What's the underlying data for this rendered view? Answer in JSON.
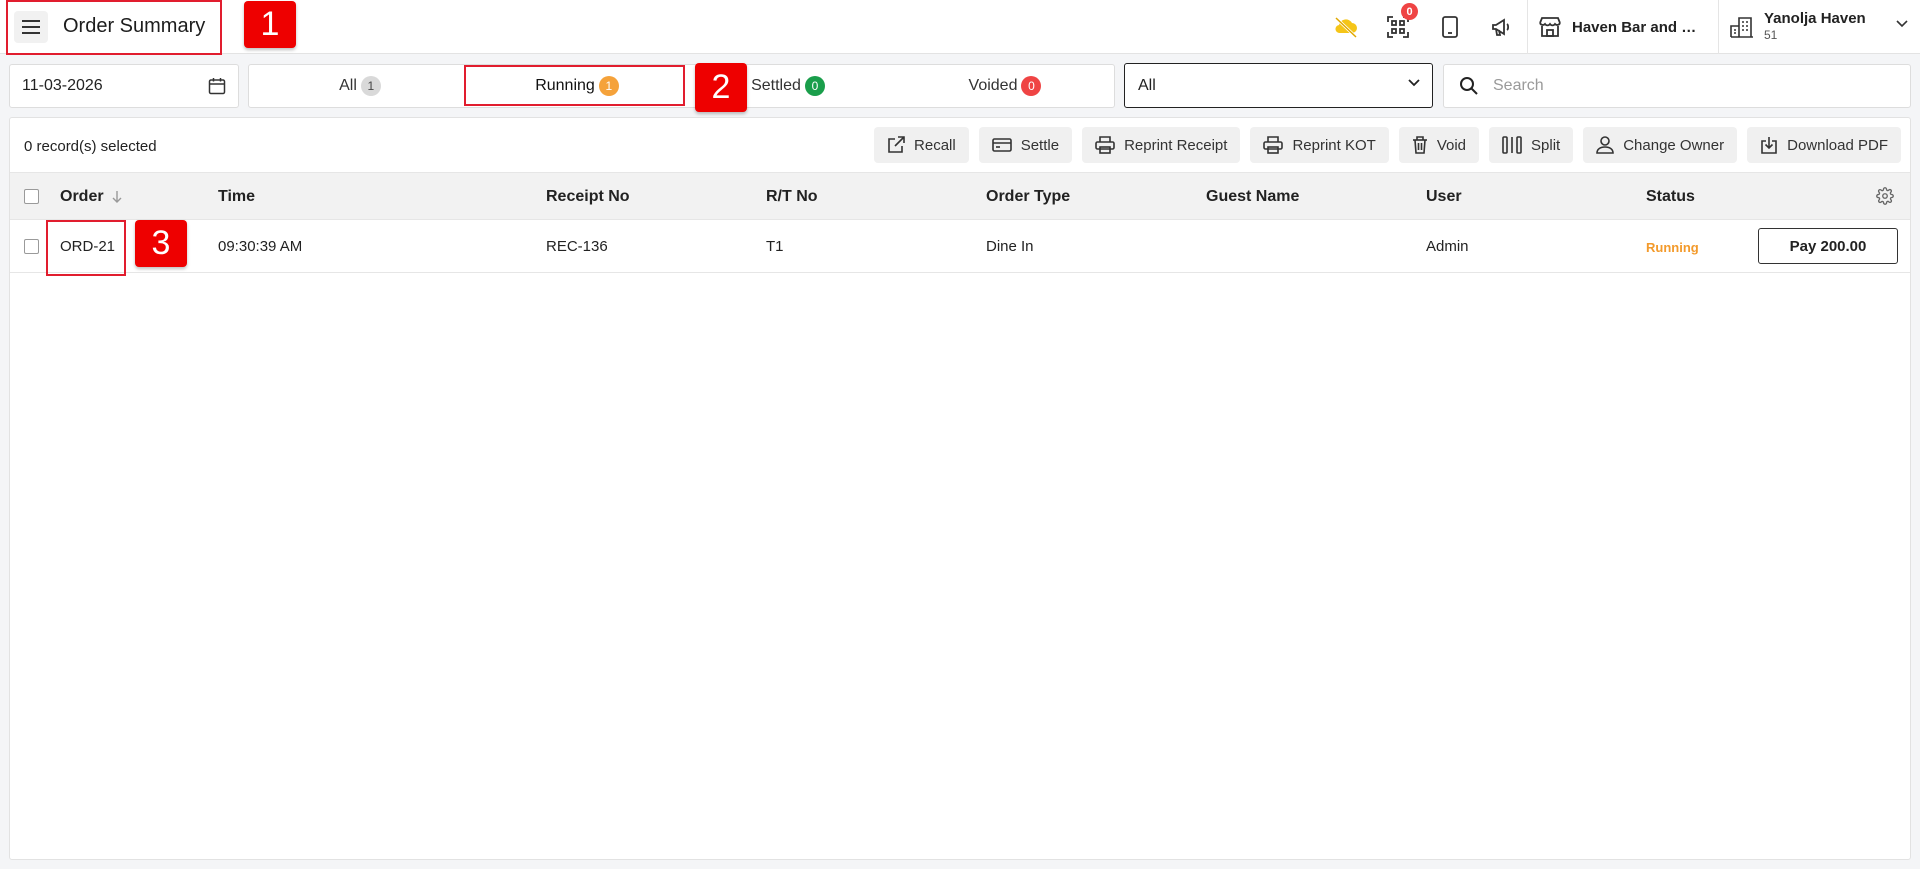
{
  "header": {
    "title": "Order Summary",
    "qr_badge_count": "0",
    "store_name": "Haven Bar and R...",
    "account_name": "Yanolja Haven",
    "account_id": "51"
  },
  "filters": {
    "date": "11-03-2026",
    "tabs": [
      {
        "label": "All",
        "count": "1",
        "color": "#d9d9d9",
        "text_color": "#444"
      },
      {
        "label": "Running",
        "count": "1",
        "color": "#f5a23a",
        "text_color": "#fff"
      },
      {
        "label": "Settled",
        "count": "0",
        "color": "#1a9e4b",
        "text_color": "#fff"
      },
      {
        "label": "Voided",
        "count": "0",
        "color": "#ef4444",
        "text_color": "#fff"
      }
    ],
    "active_tab": "Running",
    "order_type_selected": "All",
    "search_placeholder": "Search"
  },
  "toolbar": {
    "selected_text": "0 record(s) selected",
    "actions": [
      {
        "label": "Recall",
        "icon": "external-link-icon"
      },
      {
        "label": "Settle",
        "icon": "card-icon"
      },
      {
        "label": "Reprint Receipt",
        "icon": "printer-icon"
      },
      {
        "label": "Reprint KOT",
        "icon": "printer-icon"
      },
      {
        "label": "Void",
        "icon": "trash-icon"
      },
      {
        "label": "Split",
        "icon": "split-icon"
      },
      {
        "label": "Change Owner",
        "icon": "user-icon"
      },
      {
        "label": "Download PDF",
        "icon": "download-icon"
      }
    ]
  },
  "table": {
    "columns": [
      "Order",
      "Time",
      "Receipt No",
      "R/T No",
      "Order Type",
      "Guest Name",
      "User",
      "Status"
    ],
    "rows": [
      {
        "order": "ORD-21",
        "time": "09:30:39 AM",
        "receipt_no": "REC-136",
        "rt_no": "T1",
        "order_type": "Dine In",
        "guest_name": "",
        "user": "Admin",
        "status": "Running",
        "status_color": "#f39a2b",
        "pay_label": "Pay 200.00"
      }
    ]
  },
  "annotations": [
    "1",
    "2",
    "3"
  ],
  "colors": {
    "accent_red": "#e11d2e",
    "running_orange": "#f39a2b",
    "settled_green": "#1a9e4b"
  }
}
